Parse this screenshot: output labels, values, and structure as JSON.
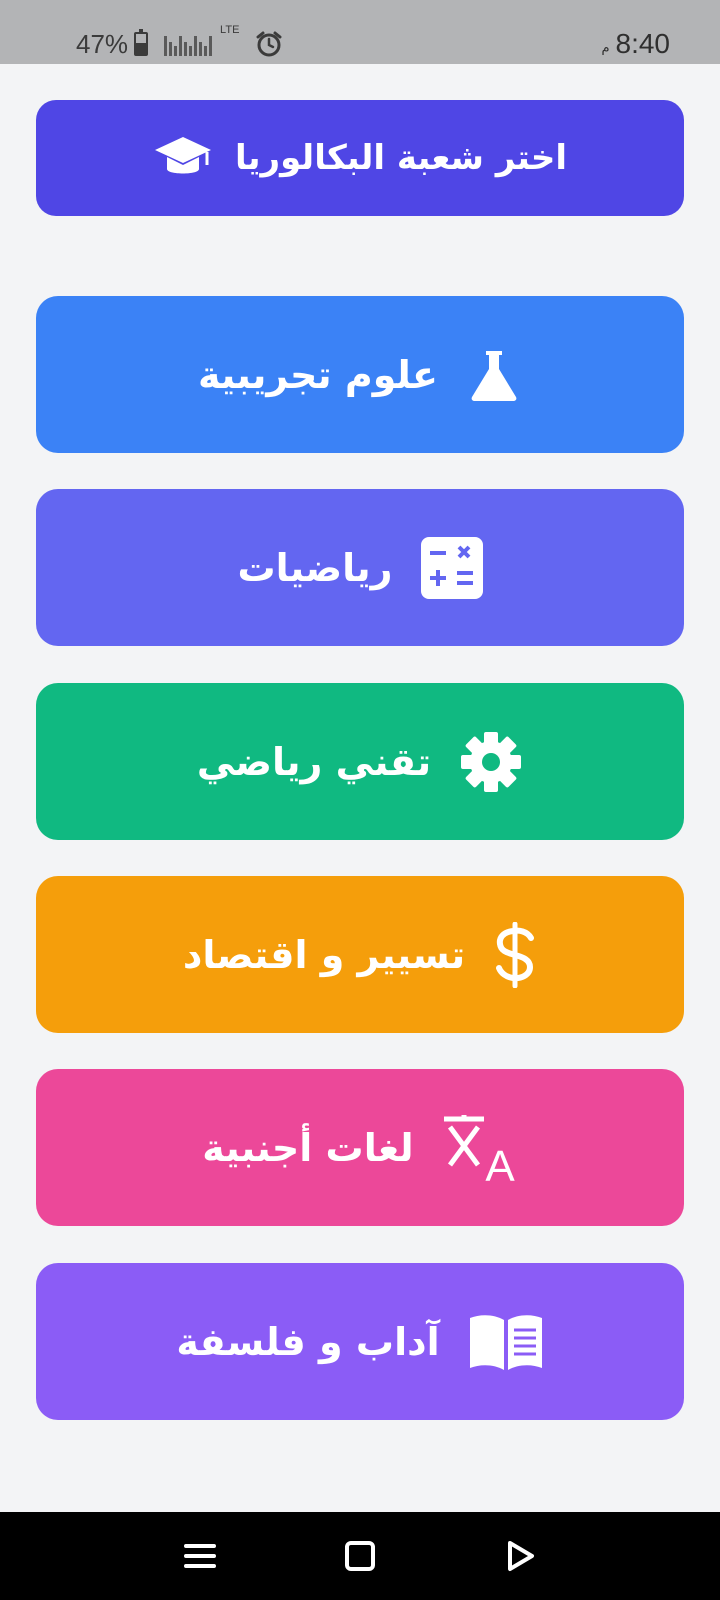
{
  "status_bar": {
    "battery": "47%",
    "network": "LTE",
    "time": "8:40",
    "ampm": "م"
  },
  "header": {
    "title": "اختر شعبة البكالوريا",
    "icon": "graduation-cap-icon",
    "color": "#4f46e5"
  },
  "branches": [
    {
      "label": "علوم تجريبية",
      "icon": "flask-icon",
      "color": "#3b82f6"
    },
    {
      "label": "رياضيات",
      "icon": "calculator-icon",
      "color": "#6366f1"
    },
    {
      "label": "تقني رياضي",
      "icon": "gear-icon",
      "color": "#10b981"
    },
    {
      "label": "تسيير و اقتصاد",
      "icon": "dollar-icon",
      "color": "#f59e0b"
    },
    {
      "label": "لغات أجنبية",
      "icon": "translate-icon",
      "color": "#ec4899"
    },
    {
      "label": "آداب و فلسفة",
      "icon": "book-icon",
      "color": "#8b5cf6"
    }
  ],
  "nav_bar": {
    "icons": [
      "menu-icon",
      "home-square-icon",
      "back-triangle-icon"
    ]
  }
}
